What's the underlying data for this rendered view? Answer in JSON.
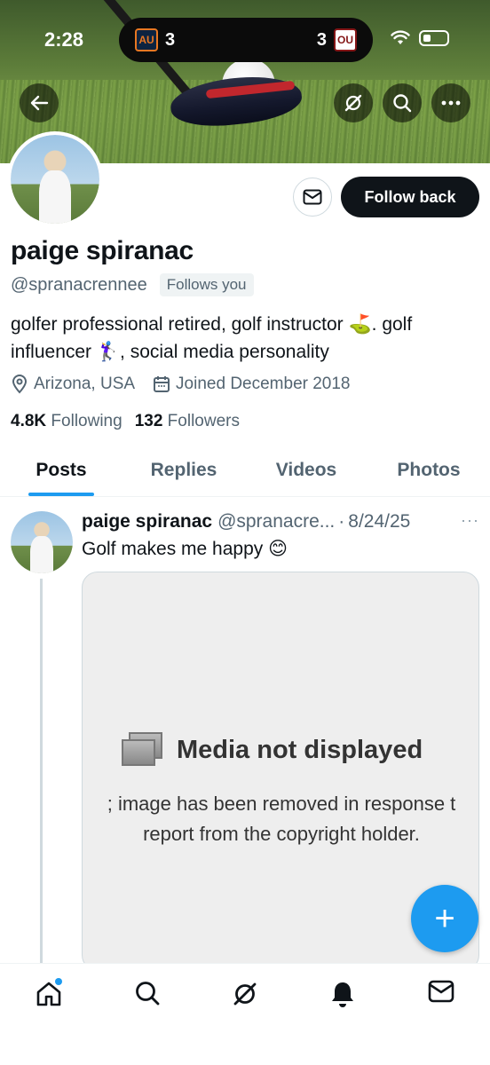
{
  "status_bar": {
    "time": "2:28",
    "score_left": "3",
    "score_right": "3",
    "team_left_logo": "AU",
    "team_right_logo": "OU"
  },
  "profile": {
    "name": "paige spiranac",
    "handle": "@spranacrennee",
    "follows_you": "Follows you",
    "bio": "golfer professional retired, golf instructor ⛳. golf influencer 🏌️‍♀️, social media personality",
    "location": "Arizona, USA",
    "joined": "Joined December 2018",
    "following_count": "4.8K",
    "following_label": "Following",
    "followers_count": "132",
    "followers_label": "Followers",
    "follow_button": "Follow back"
  },
  "tabs": [
    {
      "label": "Posts",
      "active": true
    },
    {
      "label": "Replies",
      "active": false
    },
    {
      "label": "Videos",
      "active": false
    },
    {
      "label": "Photos",
      "active": false
    }
  ],
  "post": {
    "author": "paige spiranac",
    "handle": "@spranacre...",
    "separator": "·",
    "date": "8/24/25",
    "more": "···",
    "text": "Golf makes me happy 😊",
    "media_title": "Media not displayed",
    "media_line1": "; image has been removed in response t",
    "media_line2": "report from the copyright holder."
  },
  "fab_label": "+",
  "icons": {
    "back": "arrow-left-icon",
    "grok": "grok-icon",
    "search": "search-icon",
    "more": "more-icon",
    "mail": "mail-icon",
    "location": "location-pin-icon",
    "calendar": "calendar-icon"
  },
  "nav": [
    "home-icon",
    "search-icon",
    "grok-icon",
    "notifications-icon",
    "messages-icon"
  ],
  "colors": {
    "accent": "#1d9bf0",
    "text": "#0f1419",
    "secondary": "#536471"
  }
}
